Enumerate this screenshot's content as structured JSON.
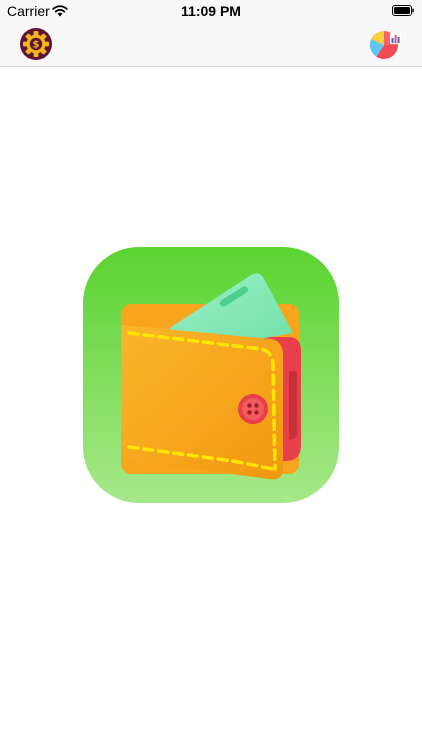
{
  "status_bar": {
    "carrier": "Carrier",
    "time": "11:09 PM",
    "icons": [
      "wifi-icon",
      "battery-icon"
    ]
  },
  "nav_bar": {
    "left_button_icon": "gear-dollar-settings-icon",
    "right_button_icon": "pie-chart-icon"
  },
  "content": {
    "illustration_icon": "wallet-app-icon"
  },
  "colors": {
    "bar_background": "#f7f7f7",
    "icon_green_top": "#5ad32f",
    "icon_green_bottom": "#a6e889",
    "wallet_orange": "#f7a51d",
    "wallet_red": "#e8404a",
    "stitch_yellow": "#ffe600",
    "gear_purple": "#5a1735",
    "gear_gold": "#f5b51c"
  }
}
